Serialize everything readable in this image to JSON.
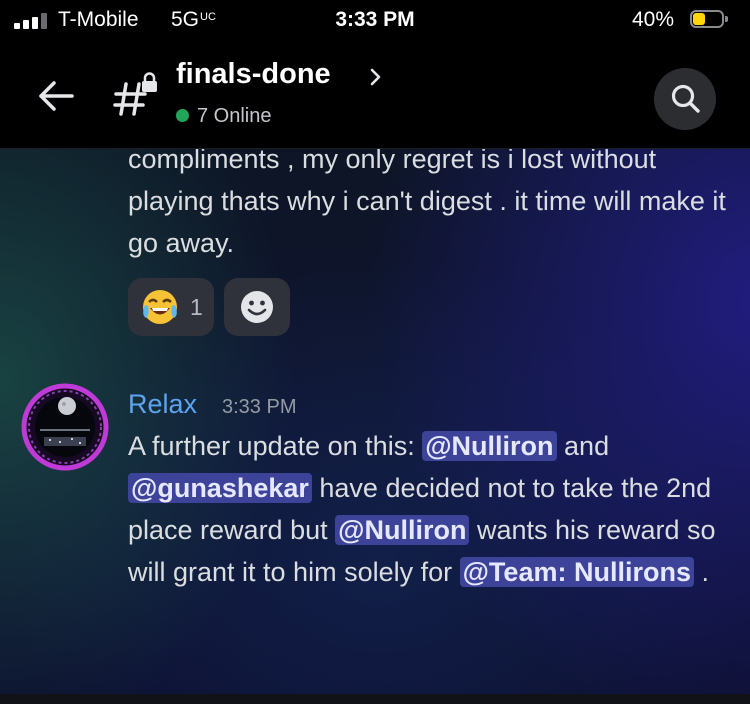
{
  "status_bar": {
    "carrier": "T-Mobile",
    "network": "5G",
    "network_sup": "UC",
    "time": "3:33 PM",
    "battery_percent": "40%",
    "battery_level": 0.4
  },
  "header": {
    "channel_name": "finals-done",
    "online_count": "7 Online"
  },
  "previous_message": {
    "text": "compliments , my only regret is i lost without playing thats why i can't digest . it time will make it go away.",
    "reactions": [
      {
        "emoji": "😂",
        "icon": "joy-emoji",
        "count": "1"
      },
      {
        "icon": "add-reaction-smiley"
      }
    ]
  },
  "message": {
    "author": "Relax",
    "timestamp": "3:33 PM",
    "parts": {
      "p1": "A further update on this: ",
      "m1": "@Nulliron",
      "p2": " and ",
      "m2": "@gunashekar",
      "p3": " have decided not to take the 2nd place reward but ",
      "m3": "@Nulliron",
      "p4": " wants his reward so will grant it to him solely for ",
      "m4": "@Team: Nullirons",
      "p5": " ."
    }
  },
  "colors": {
    "author": "#5da4f0",
    "mention_bg": "#3c4399",
    "online_dot": "#23a55a",
    "battery": "#ffd60a"
  }
}
